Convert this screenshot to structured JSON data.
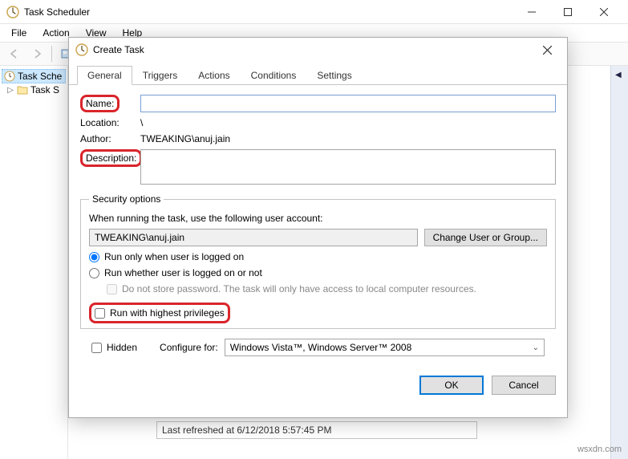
{
  "app": {
    "title": "Task Scheduler",
    "menus": [
      "File",
      "Action",
      "View",
      "Help"
    ]
  },
  "tree": {
    "root": "Task Sche",
    "child": "Task S"
  },
  "status": "Last refreshed at 6/12/2018 5:57:45 PM",
  "watermark": "wsxdn.com",
  "dialog": {
    "title": "Create Task",
    "tabs": [
      "General",
      "Triggers",
      "Actions",
      "Conditions",
      "Settings"
    ],
    "fields": {
      "name_label": "Name:",
      "name_value": "",
      "location_label": "Location:",
      "location_value": "\\",
      "author_label": "Author:",
      "author_value": "TWEAKING\\anuj.jain",
      "desc_label": "Description:",
      "desc_value": ""
    },
    "security": {
      "legend": "Security options",
      "prompt": "When running the task, use the following user account:",
      "user": "TWEAKING\\anuj.jain",
      "change_btn": "Change User or Group...",
      "radio1": "Run only when user is logged on",
      "radio2": "Run whether user is logged on or not",
      "store_pw": "Do not store password. The task will only have access to local computer resources.",
      "highest": "Run with highest privileges"
    },
    "bottom": {
      "hidden": "Hidden",
      "configure_label": "Configure for:",
      "configure_value": "Windows Vista™, Windows Server™ 2008"
    },
    "footer": {
      "ok": "OK",
      "cancel": "Cancel"
    }
  }
}
